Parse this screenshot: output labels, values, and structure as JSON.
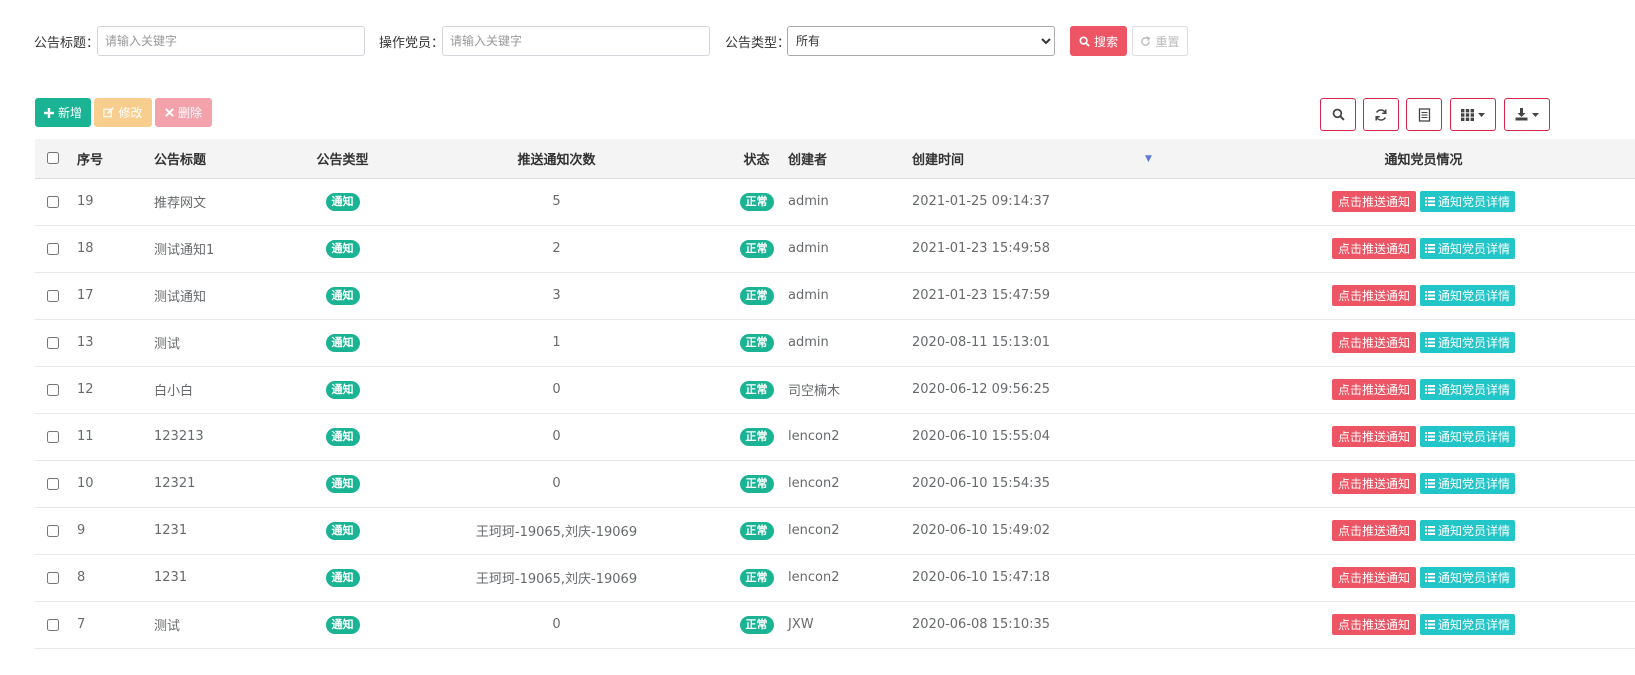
{
  "search": {
    "title_label": "公告标题：",
    "title_placeholder": "请输入关键字",
    "operator_label": "操作党员：",
    "operator_placeholder": "请输入关键字",
    "type_label": "公告类型：",
    "type_selected": "所有",
    "search_button": "搜索",
    "reset_button": "重置"
  },
  "toolbar": {
    "add_label": "新增",
    "edit_label": "修改",
    "delete_label": "删除"
  },
  "table": {
    "headers": {
      "seq": "序号",
      "title": "公告标题",
      "type": "公告类型",
      "push_count": "推送通知次数",
      "status": "状态",
      "creator": "创建者",
      "created_at": "创建时间",
      "notify": "通知党员情况"
    },
    "action_push": "点击推送通知",
    "action_detail": "通知党员详情",
    "rows": [
      {
        "seq": "19",
        "title": "推荐网文",
        "type": "通知",
        "push": "5",
        "status": "正常",
        "creator": "admin",
        "time": "2021-01-25 09:14:37"
      },
      {
        "seq": "18",
        "title": "测试通知1",
        "type": "通知",
        "push": "2",
        "status": "正常",
        "creator": "admin",
        "time": "2021-01-23 15:49:58"
      },
      {
        "seq": "17",
        "title": "测试通知",
        "type": "通知",
        "push": "3",
        "status": "正常",
        "creator": "admin",
        "time": "2021-01-23 15:47:59"
      },
      {
        "seq": "13",
        "title": "测试",
        "type": "通知",
        "push": "1",
        "status": "正常",
        "creator": "admin",
        "time": "2020-08-11 15:13:01"
      },
      {
        "seq": "12",
        "title": "白小白",
        "type": "通知",
        "push": "0",
        "status": "正常",
        "creator": "司空楠木",
        "time": "2020-06-12 09:56:25"
      },
      {
        "seq": "11",
        "title": "123213",
        "type": "通知",
        "push": "0",
        "status": "正常",
        "creator": "lencon2",
        "time": "2020-06-10 15:55:04"
      },
      {
        "seq": "10",
        "title": "12321",
        "type": "通知",
        "push": "0",
        "status": "正常",
        "creator": "lencon2",
        "time": "2020-06-10 15:54:35"
      },
      {
        "seq": "9",
        "title": "1231",
        "type": "通知",
        "push": "王珂珂-19065,刘庆-19069",
        "status": "正常",
        "creator": "lencon2",
        "time": "2020-06-10 15:49:02"
      },
      {
        "seq": "8",
        "title": "1231",
        "type": "通知",
        "push": "王珂珂-19065,刘庆-19069",
        "status": "正常",
        "creator": "lencon2",
        "time": "2020-06-10 15:47:18"
      },
      {
        "seq": "7",
        "title": "测试",
        "type": "通知",
        "push": "0",
        "status": "正常",
        "creator": "JXW",
        "time": "2020-06-08 15:10:35"
      }
    ]
  }
}
